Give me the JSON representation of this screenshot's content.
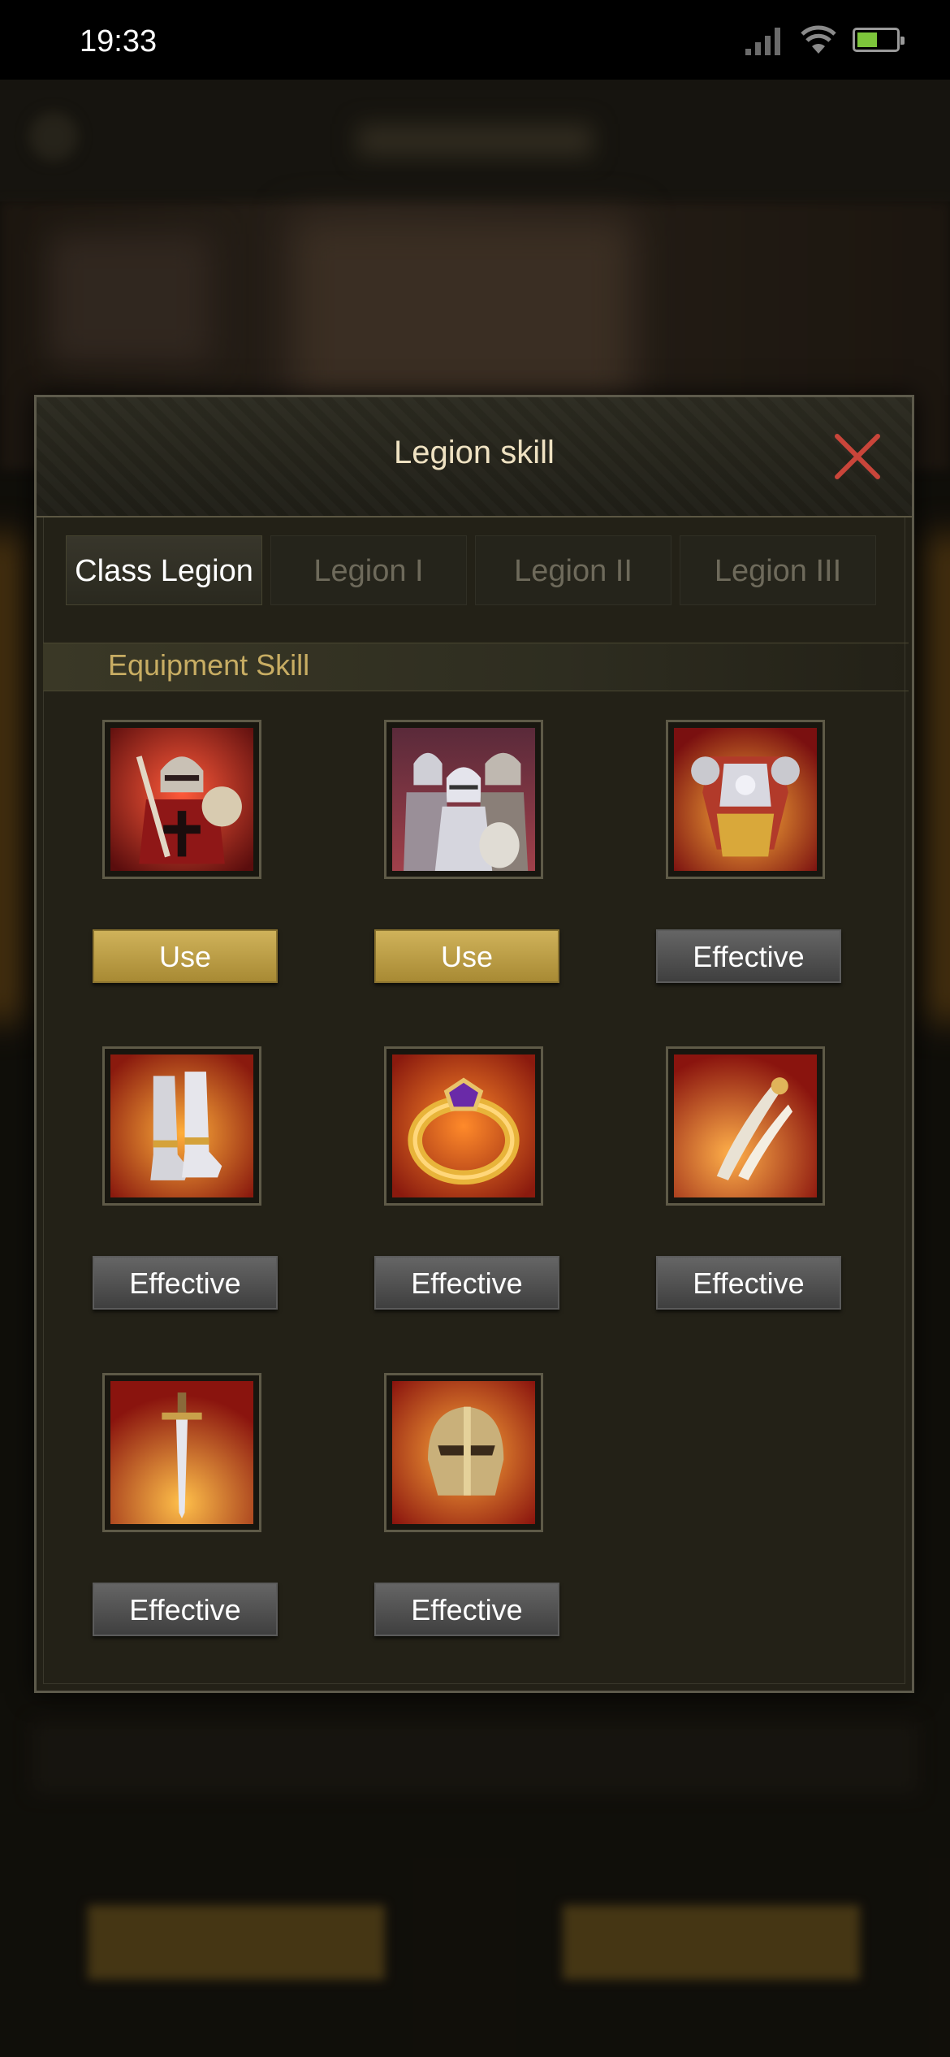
{
  "status_bar": {
    "time": "19:33"
  },
  "modal": {
    "title": "Legion skill",
    "tabs": [
      {
        "label": "Class Legion",
        "active": true
      },
      {
        "label": "Legion I",
        "active": false
      },
      {
        "label": "Legion II",
        "active": false
      },
      {
        "label": "Legion III",
        "active": false
      }
    ],
    "section_title": "Equipment Skill",
    "skills": [
      {
        "icon": "crusader-knight-icon",
        "button": "Use",
        "state": "use"
      },
      {
        "icon": "knight-squad-icon",
        "button": "Use",
        "state": "use"
      },
      {
        "icon": "armor-gauntlet-icon",
        "button": "Effective",
        "state": "effective"
      },
      {
        "icon": "greaves-boots-icon",
        "button": "Effective",
        "state": "effective"
      },
      {
        "icon": "gem-ring-icon",
        "button": "Effective",
        "state": "effective"
      },
      {
        "icon": "dagger-icon",
        "button": "Effective",
        "state": "effective"
      },
      {
        "icon": "sword-icon",
        "button": "Effective",
        "state": "effective"
      },
      {
        "icon": "helmet-icon",
        "button": "Effective",
        "state": "effective"
      }
    ]
  },
  "colors": {
    "use_button": "#c2a44f",
    "effective_button": "#555555",
    "section_title": "#c8ad63",
    "close_icon": "#c9453a"
  }
}
